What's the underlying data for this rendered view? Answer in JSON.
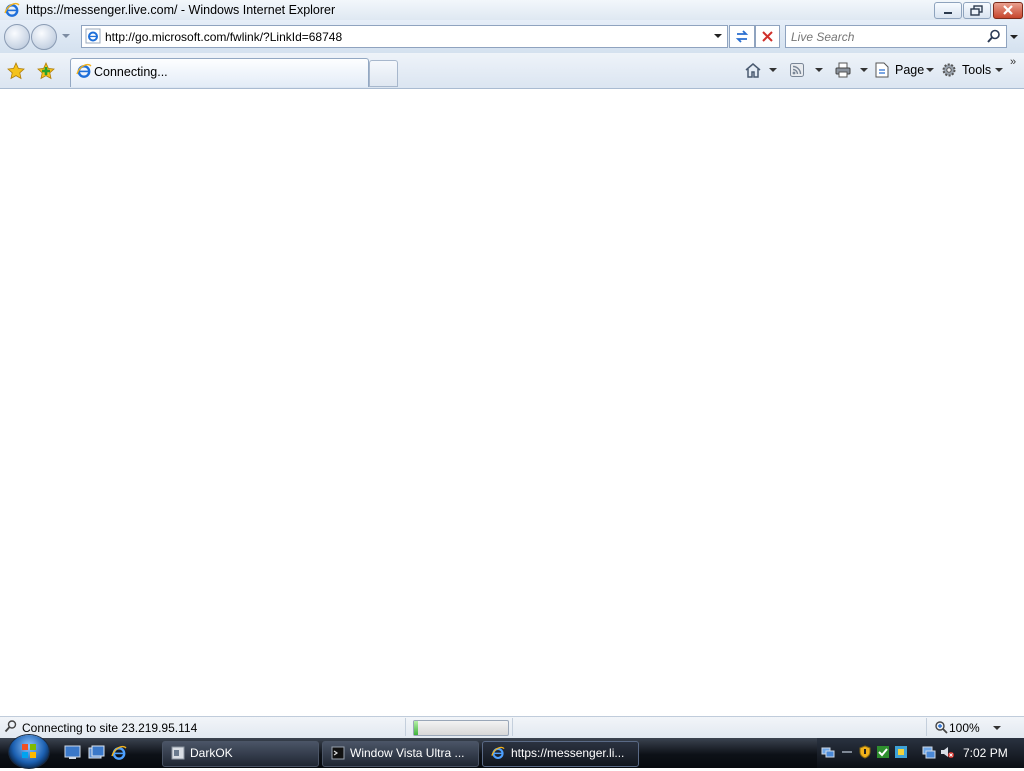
{
  "window": {
    "title": "https://messenger.live.com/ - Windows Internet Explorer"
  },
  "address_bar": {
    "url": "http://go.microsoft.com/fwlink/?LinkId=68748"
  },
  "search": {
    "placeholder": "Live Search"
  },
  "tabs": [
    {
      "label": "Connecting..."
    }
  ],
  "command_bar": {
    "page_label": "Page",
    "tools_label": "Tools"
  },
  "status_bar": {
    "text": "Connecting to site 23.219.95.114",
    "progress_fraction": 0.04,
    "zoom": "100%"
  },
  "taskbar": {
    "buttons": [
      {
        "label": "DarkOK"
      },
      {
        "label": "Window Vista Ultra ..."
      },
      {
        "label": "https://messenger.li..."
      }
    ],
    "clock": "7:02 PM"
  },
  "colors": {
    "ie_blue": "#1e6fd9",
    "ie_gold": "#f2b21b",
    "close_red": "#c6452c"
  }
}
